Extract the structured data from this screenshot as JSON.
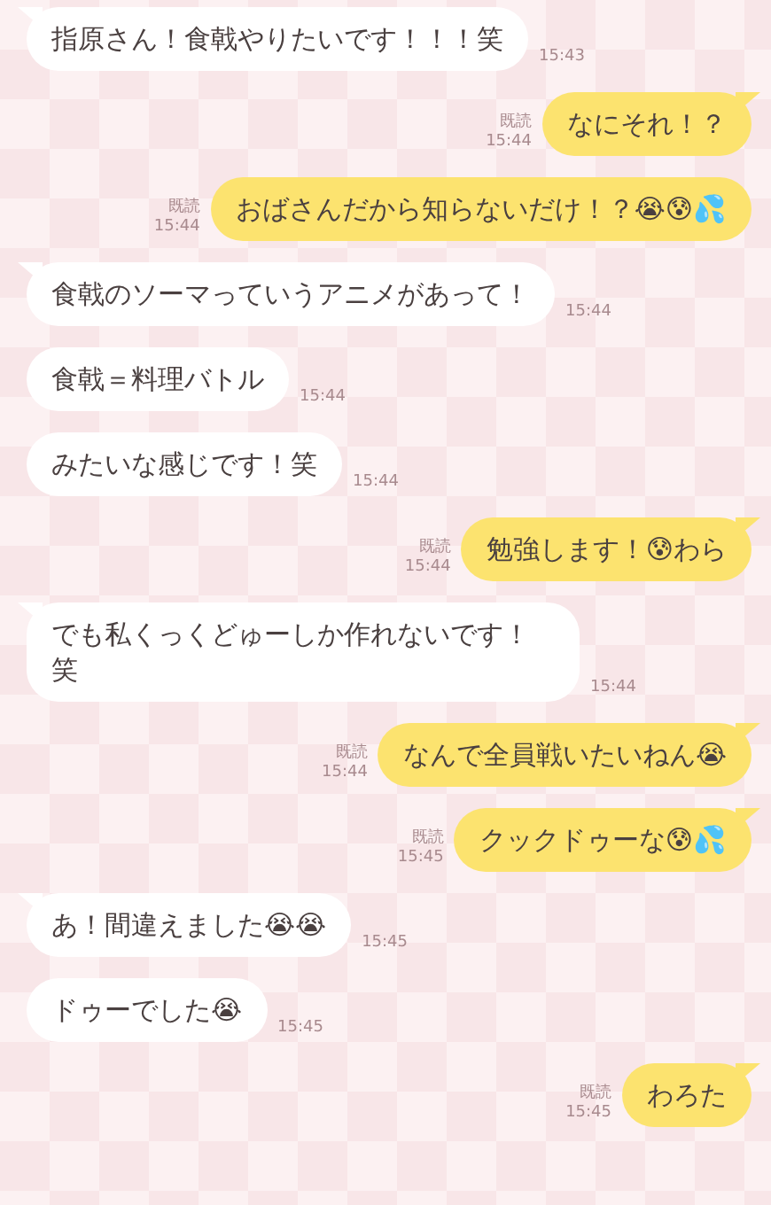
{
  "messages": [
    {
      "kind": "incoming",
      "text": "指原さん！食戟やりたいです！！！笑",
      "time": "15:43",
      "tail": true
    },
    {
      "kind": "outgoing",
      "text": "なにそれ！？",
      "read": "既読",
      "time": "15:44",
      "tail": true
    },
    {
      "kind": "outgoing",
      "text": "おばさんだから知らないだけ！？😭😰💦",
      "read": "既読",
      "time": "15:44",
      "tail": false
    },
    {
      "kind": "incoming",
      "text": "食戟のソーマっていうアニメがあって！",
      "time": "15:44",
      "tail": true
    },
    {
      "kind": "incoming",
      "text": "食戟＝料理バトル",
      "time": "15:44",
      "tail": false
    },
    {
      "kind": "incoming",
      "text": "みたいな感じです！笑",
      "time": "15:44",
      "tail": false
    },
    {
      "kind": "outgoing",
      "text": "勉強します！😰わら",
      "read": "既読",
      "time": "15:44",
      "tail": true
    },
    {
      "kind": "incoming",
      "text": "でも私くっくどゅーしか作れないです！笑",
      "time": "15:44",
      "tail": true
    },
    {
      "kind": "outgoing",
      "text": "なんで全員戦いたいねん😭",
      "read": "既読",
      "time": "15:44",
      "tail": true
    },
    {
      "kind": "outgoing",
      "text": "クックドゥーな😰💦",
      "read": "既読",
      "time": "15:45",
      "tail": true
    },
    {
      "kind": "incoming",
      "text": "あ！間違えました😭😭",
      "time": "15:45",
      "tail": true
    },
    {
      "kind": "incoming",
      "text": "ドゥーでした😭",
      "time": "15:45",
      "tail": false
    },
    {
      "kind": "outgoing",
      "text": "わろた",
      "read": "既読",
      "time": "15:45",
      "tail": true
    }
  ]
}
